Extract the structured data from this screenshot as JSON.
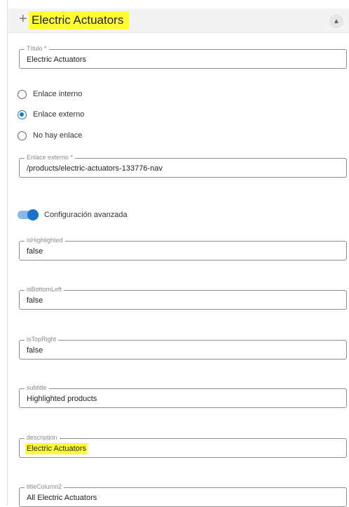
{
  "header": {
    "title": "Electric Actuators",
    "expand_icon": "plus-icon",
    "collapse_icon": "chevron-up-icon"
  },
  "fields": {
    "titulo": {
      "label": "Título *",
      "value": "Electric Actuators"
    },
    "enlace_externo": {
      "label": "Enlace externo *",
      "value": "/products/electric-actuators-133776-nav"
    },
    "is_highlighted": {
      "label": "isHighlighted",
      "value": "false"
    },
    "is_bottom_left": {
      "label": "isBottomLeft",
      "value": "false"
    },
    "is_top_right": {
      "label": "isTopRight",
      "value": "false"
    },
    "subtitle": {
      "label": "subtitle",
      "value": "Highlighted products"
    },
    "description": {
      "label": "description",
      "value": "Electric Actuators"
    },
    "title_column2": {
      "label": "titleColumn2",
      "value": "All Electric Actuators"
    }
  },
  "link_options": [
    {
      "label": "Enlace interno",
      "selected": false
    },
    {
      "label": "Enlace externo",
      "selected": true
    },
    {
      "label": "No hay enlace",
      "selected": false
    }
  ],
  "advanced_toggle": {
    "label": "Configuración avanzada",
    "on": true
  },
  "colors": {
    "accent": "#1a73c8",
    "highlight": "#ffff33"
  }
}
